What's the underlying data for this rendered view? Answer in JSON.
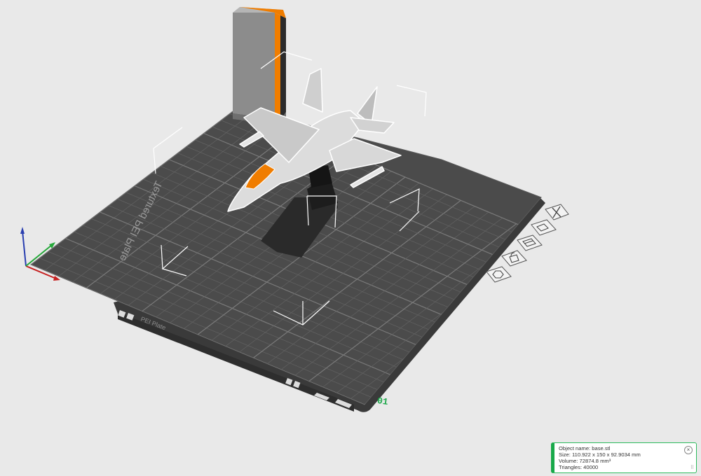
{
  "plate": {
    "label": "01",
    "bed_text": "Textured PEI Plate"
  },
  "plate_toolbar": {
    "items": [
      {
        "name": "close-plate",
        "icon": "close-icon"
      },
      {
        "name": "auto-orient",
        "icon": "orient-icon"
      },
      {
        "name": "arrange",
        "icon": "arrange-icon"
      },
      {
        "name": "lock",
        "icon": "lock-icon"
      },
      {
        "name": "plate-settings",
        "icon": "gear-icon"
      }
    ]
  },
  "object_info": {
    "name_line": "Object name: base.stl",
    "size_line": "Size: 110.922 x 150 x 92.9034 mm",
    "volume_line": "Volume: 72874.8 mm³",
    "triangles_line": "Triangles: 40000"
  },
  "colors": {
    "background": "#e9e9e9",
    "bed": "#4a4a4a",
    "grid": "#6a6a6a",
    "accent_orange": "#f07d00",
    "status_green": "#19a94a"
  }
}
